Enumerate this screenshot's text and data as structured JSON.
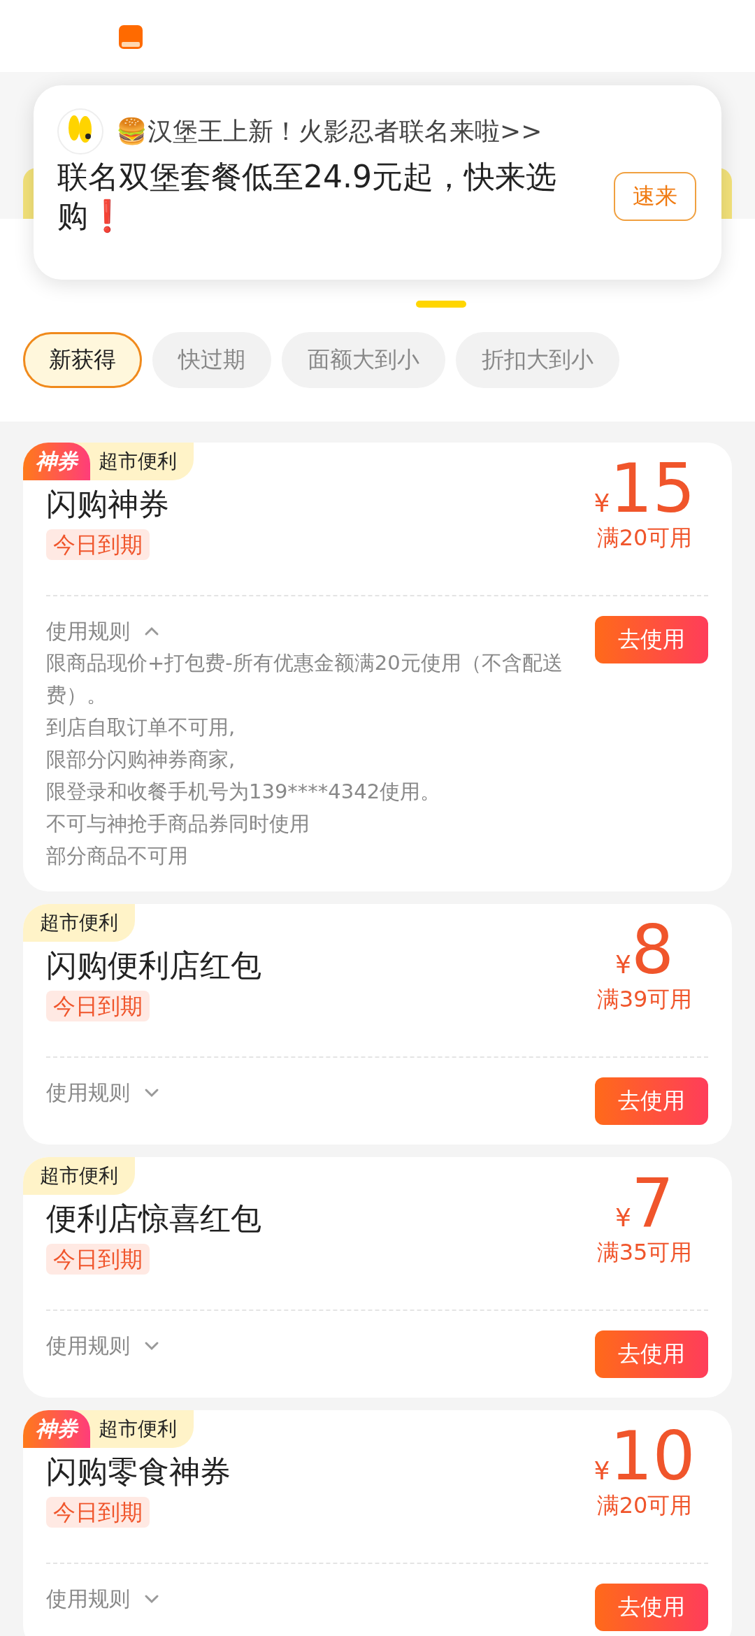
{
  "notification": {
    "title": "🍔汉堡王上新！火影忍者联名来啦>>",
    "body": "联名双堡套餐低至24.9元起，快来选购❗",
    "button": "速来"
  },
  "filters": [
    {
      "label": "新获得",
      "selected": true
    },
    {
      "label": "快过期",
      "selected": false
    },
    {
      "label": "面额大到小",
      "selected": false
    },
    {
      "label": "折扣大到小",
      "selected": false
    }
  ],
  "coupons": [
    {
      "tags": [
        {
          "kind": "super",
          "label": "神券"
        },
        {
          "kind": "category",
          "label": "超市便利"
        }
      ],
      "name": "闪购神券",
      "expiry": "今日到期",
      "currency": "¥",
      "amount": "15",
      "condition": "满20可用",
      "rules_label": "使用规则",
      "expanded": true,
      "rules": [
        "限商品现价+打包费-所有优惠金额满20元使用（不含配送费）。",
        "到店自取订单不可用,",
        "限部分闪购神券商家,",
        "限登录和收餐手机号为139****4342使用。",
        "不可与神抢手商品券同时使用",
        "部分商品不可用"
      ],
      "button": "去使用"
    },
    {
      "tags": [
        {
          "kind": "category",
          "label": "超市便利"
        }
      ],
      "name": "闪购便利店红包",
      "expiry": "今日到期",
      "currency": "¥",
      "amount": "8",
      "condition": "满39可用",
      "rules_label": "使用规则",
      "expanded": false,
      "button": "去使用"
    },
    {
      "tags": [
        {
          "kind": "category",
          "label": "超市便利"
        }
      ],
      "name": "便利店惊喜红包",
      "expiry": "今日到期",
      "currency": "¥",
      "amount": "7",
      "condition": "满35可用",
      "rules_label": "使用规则",
      "expanded": false,
      "button": "去使用"
    },
    {
      "tags": [
        {
          "kind": "super",
          "label": "神券"
        },
        {
          "kind": "category",
          "label": "超市便利"
        }
      ],
      "name": "闪购零食神券",
      "expiry": "今日到期",
      "currency": "¥",
      "amount": "10",
      "condition": "满20可用",
      "rules_label": "使用规则",
      "expanded": false,
      "button": "去使用"
    }
  ]
}
